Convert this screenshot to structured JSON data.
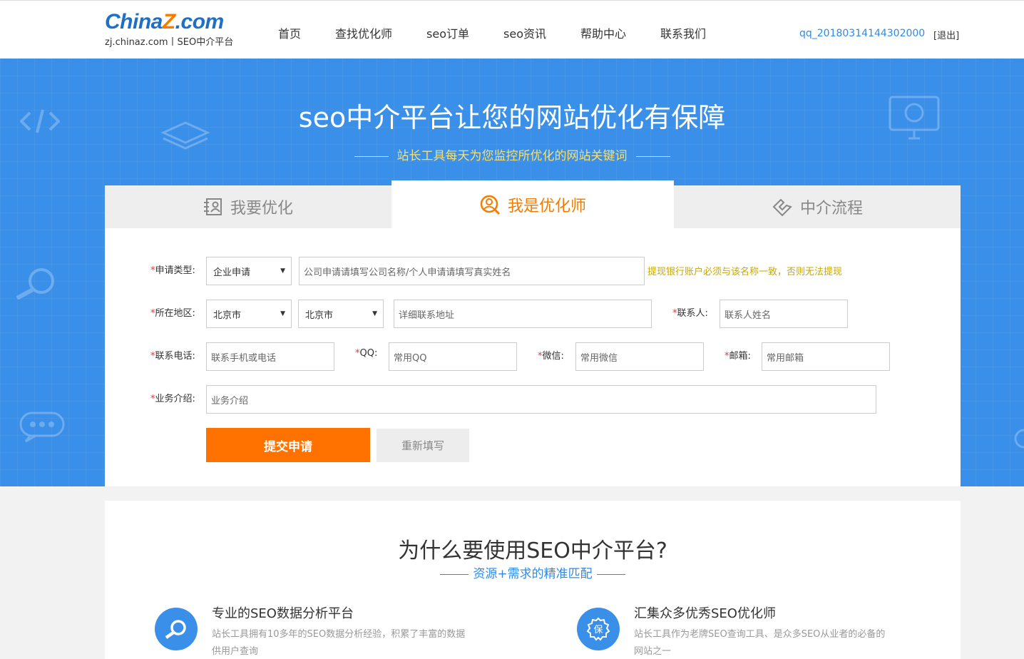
{
  "logo": {
    "main_a": "China",
    "main_z": "Z",
    "main_b": ".com",
    "sub": "zj.chinaz.com丨SEO中介平台"
  },
  "nav": [
    "首页",
    "查找优化师",
    "seo订单",
    "seo资讯",
    "帮助中心",
    "联系我们"
  ],
  "user": {
    "name": "qq_20180314144302000",
    "logout": "[退出]"
  },
  "banner": {
    "title": "seo中介平台让您的网站优化有保障",
    "subtitle": "站长工具每天为您监控所优化的网站关键词"
  },
  "tabs": [
    {
      "label": "我要优化",
      "icon": "contact-card-icon",
      "active": false
    },
    {
      "label": "我是优化师",
      "icon": "user-search-icon",
      "active": true
    },
    {
      "label": "中介流程",
      "icon": "handshake-icon",
      "active": false
    }
  ],
  "form": {
    "type_label": "申请类型:",
    "type_value": "企业申请",
    "name_placeholder": "公司申请请填写公司名称/个人申请请填写真实姓名",
    "name_hint": "提现银行账户必须与该名称一致，否则无法提现",
    "region_label": "所在地区:",
    "province_value": "北京市",
    "city_value": "北京市",
    "address_placeholder": "详细联系地址",
    "contact_label": "联系人:",
    "contact_placeholder": "联系人姓名",
    "phone_label": "联系电话:",
    "phone_placeholder": "联系手机或电话",
    "qq_label": "QQ:",
    "qq_placeholder": "常用QQ",
    "wechat_label": "微信:",
    "wechat_placeholder": "常用微信",
    "email_label": "邮箱:",
    "email_placeholder": "常用邮箱",
    "intro_label": "业务介绍:",
    "intro_placeholder": "业务介绍",
    "required_mark": "*",
    "submit_label": "提交申请",
    "reset_label": "重新填写"
  },
  "why": {
    "title": "为什么要使用SEO中介平台?",
    "subtitle": "资源+需求的精准匹配",
    "features": [
      {
        "icon": "search-icon",
        "title": "专业的SEO数据分析平台",
        "desc": "站长工具拥有10多年的SEO数据分析经验，积累了丰富的数据供用户查询"
      },
      {
        "icon": "badge-icon",
        "title": "汇集众多优秀SEO优化师",
        "desc": "站长工具作为老牌SEO查询工具、是众多SEO从业者的必备的网站之一"
      }
    ]
  },
  "colors": {
    "brand_blue": "#3a8fe9",
    "accent_orange": "#ff7200",
    "hint_yellow": "#c8a800"
  }
}
